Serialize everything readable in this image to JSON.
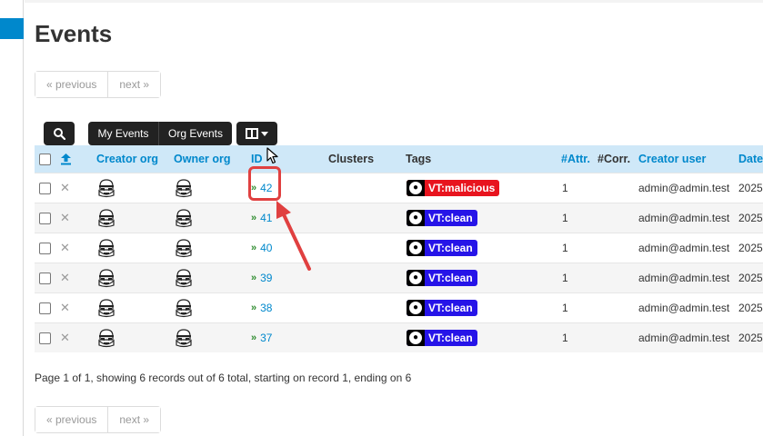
{
  "page": {
    "title": "Events"
  },
  "pager_top": {
    "previous": "« previous",
    "next": "next »"
  },
  "pager_bottom": {
    "previous": "« previous",
    "next": "next »"
  },
  "toolbar": {
    "my_events": "My Events",
    "org_events": "Org Events"
  },
  "table": {
    "headers": {
      "creator_org": "Creator org",
      "owner_org": "Owner org",
      "id": "ID",
      "clusters": "Clusters",
      "tags": "Tags",
      "attr": "#Attr.",
      "corr": "#Corr.",
      "creator_user": "Creator user",
      "date": "Date"
    },
    "rows": [
      {
        "id": "42",
        "tag": "VT:malicious",
        "tag_color": "#e8141e",
        "attr": "1",
        "creator_user": "admin@admin.test",
        "date": "2025"
      },
      {
        "id": "41",
        "tag": "VT:clean",
        "tag_color": "#2614e8",
        "attr": "1",
        "creator_user": "admin@admin.test",
        "date": "2025"
      },
      {
        "id": "40",
        "tag": "VT:clean",
        "tag_color": "#2614e8",
        "attr": "1",
        "creator_user": "admin@admin.test",
        "date": "2025"
      },
      {
        "id": "39",
        "tag": "VT:clean",
        "tag_color": "#2614e8",
        "attr": "1",
        "creator_user": "admin@admin.test",
        "date": "2025"
      },
      {
        "id": "38",
        "tag": "VT:clean",
        "tag_color": "#2614e8",
        "attr": "1",
        "creator_user": "admin@admin.test",
        "date": "2025"
      },
      {
        "id": "37",
        "tag": "VT:clean",
        "tag_color": "#2614e8",
        "attr": "1",
        "creator_user": "admin@admin.test",
        "date": "2025"
      }
    ]
  },
  "summary": "Page 1 of 1, showing 6 records out of 6 total, starting on record 1, ending on 6",
  "icons": {
    "search": "search-icon",
    "columns": "columns-icon",
    "delete": "delete-icon",
    "upload": "upload-icon",
    "expand": "expand-chevron-icon",
    "globe": "globe-icon",
    "org_logo": "stormtrooper-logo-icon"
  },
  "colors": {
    "accent": "#0088cc",
    "header_bg": "#cfe8f8",
    "annotation": "#e04040"
  }
}
